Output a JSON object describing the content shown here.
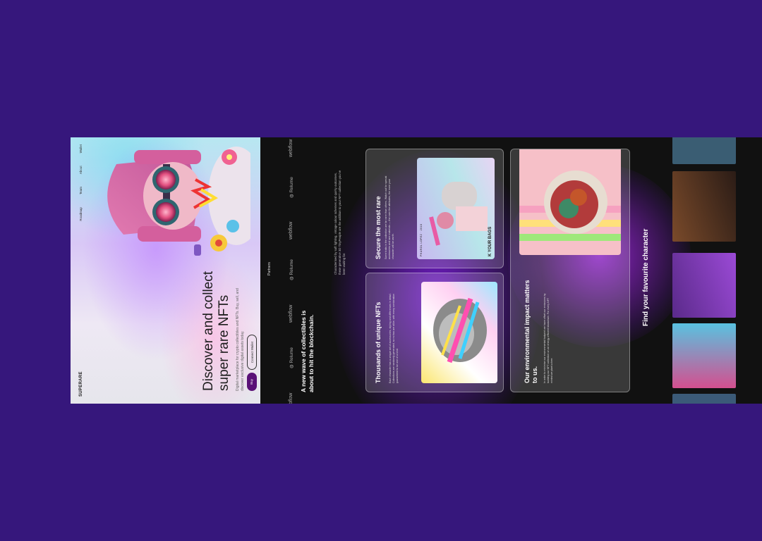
{
  "nav": {
    "logo": "SUPERARE",
    "links": [
      "Roadmap",
      "Team",
      "About",
      "Wallet"
    ]
  },
  "hero": {
    "title": "Discover and collect super rare NFTs",
    "description": "Digital marketplace for crypto collectibles and NFTs. Buy, sell, and discover exclusive digital assets today.",
    "buy_label": "Buy",
    "connect_label": "Connect Wallet"
  },
  "partners": {
    "label": "Partners",
    "items": [
      "webflow",
      "Relume",
      "webflow",
      "Relume",
      "webflow",
      "Relume",
      "webflow"
    ]
  },
  "intro": {
    "title": "A new wave of collectibles is about to hit the blockchain.",
    "description": "Characterised by soft lighting, vintage colour schemes and quirky outcomes, these generative 3D TinyPeople are the addition to your NFT collection you've been waiting for."
  },
  "cards": [
    {
      "title": "Thousands of unique NFTs",
      "body": "Each character has a unique set of accessories, styling and differences in detail. Collections are randomly generated, so no two are alike, with every combination guaranteed to be one of a kind."
    },
    {
      "title": "Secure the most rare",
      "body": "Some traits in the collection are far rarer than others. Watch out for special accessories and rare materials — the rarer the attributes, the more your character will be worth.",
      "image_caption_top": "PHAROL LOPEZ · 2018",
      "image_caption_bottom": "K YOUR BAGS"
    },
    {
      "title": "Our environmental impact matters to us.",
      "body": "In order to minimise our environmental footprint we have offset our emissions by building our NFT collection on an energy-efficient blockchain. For every NFT minted we plant a tree."
    }
  ],
  "gallery": {
    "title": "Find your favourite character"
  }
}
